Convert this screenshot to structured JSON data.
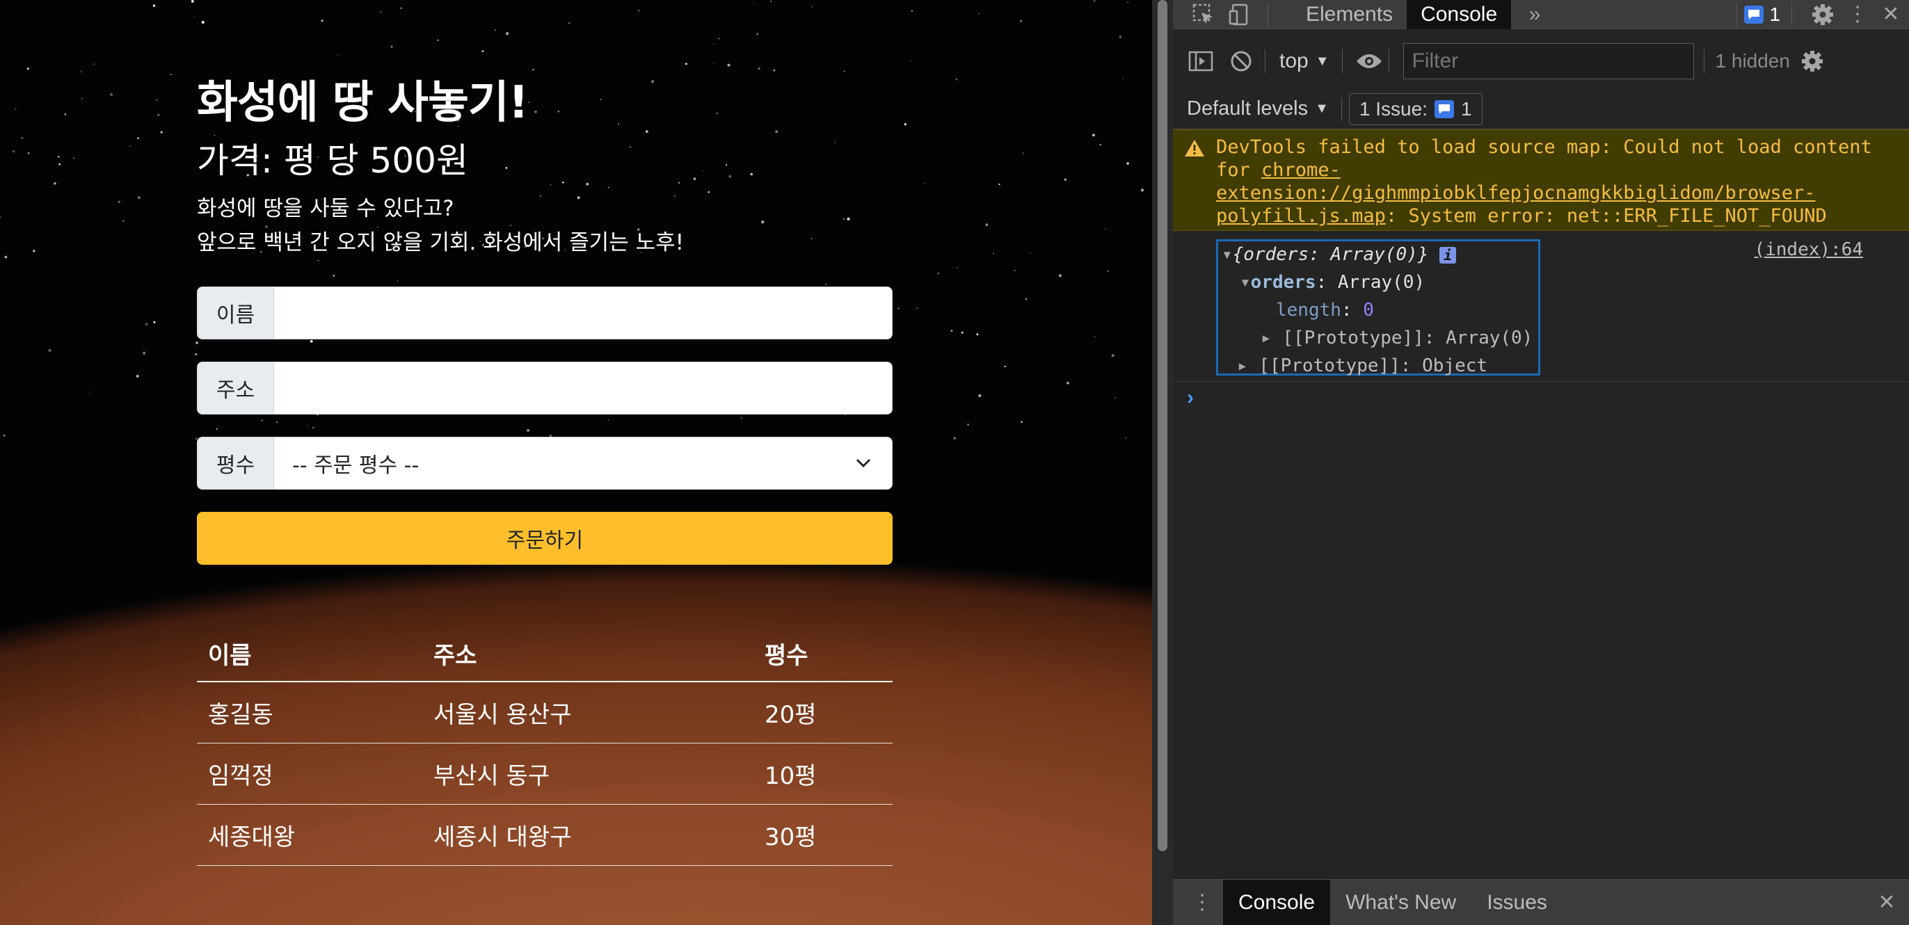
{
  "page": {
    "title": "화성에 땅 사놓기!",
    "price": "가격: 평 당 500원",
    "desc_line1": "화성에 땅을 사둘 수 있다고?",
    "desc_line2": "앞으로 백년 간 오지 않을 기회. 화성에서 즐기는 노후!",
    "form": {
      "name_label": "이름",
      "name_value": "",
      "address_label": "주소",
      "address_value": "",
      "size_label": "평수",
      "size_selected": "-- 주문 평수 --",
      "order_button": "주문하기"
    },
    "table": {
      "headers": [
        "이름",
        "주소",
        "평수"
      ],
      "rows": [
        [
          "홍길동",
          "서울시 용산구",
          "20평"
        ],
        [
          "임꺽정",
          "부산시 동구",
          "10평"
        ],
        [
          "세종대왕",
          "세종시 대왕구",
          "30평"
        ]
      ]
    }
  },
  "devtools": {
    "tabs": [
      "Elements",
      "Console"
    ],
    "active_tab": "Console",
    "issues_badge": "1",
    "context": "top",
    "filter_placeholder": "Filter",
    "hidden_count": "1 hidden",
    "levels": "Default levels",
    "issue_button": "1 Issue:",
    "issue_count": "1",
    "warning": {
      "prefix": "DevTools failed to load source map: Could not load content for ",
      "link": "chrome-extension://gighmmpiobklfepjocnamgkkbiglidom/browser-polyfill.js.map",
      "suffix": ": System error: net::ERR_FILE_NOT_FOUND"
    },
    "log": {
      "summary": "{orders: Array(0)}",
      "source": "(index):64",
      "line_orders_key": "orders",
      "line_orders_val": "Array(0)",
      "line_length_key": "length",
      "line_length_val": "0",
      "line_proto1": "[[Prototype]]: Array(0)",
      "line_proto2": "[[Prototype]]: Object"
    },
    "drawer_tabs": [
      "Console",
      "What's New",
      "Issues"
    ]
  },
  "colors": {
    "accent_button": "#ffbf2b",
    "devtools_bg": "#242424",
    "warning_text": "#f5bd45",
    "selection_border": "#1a6bb8"
  }
}
